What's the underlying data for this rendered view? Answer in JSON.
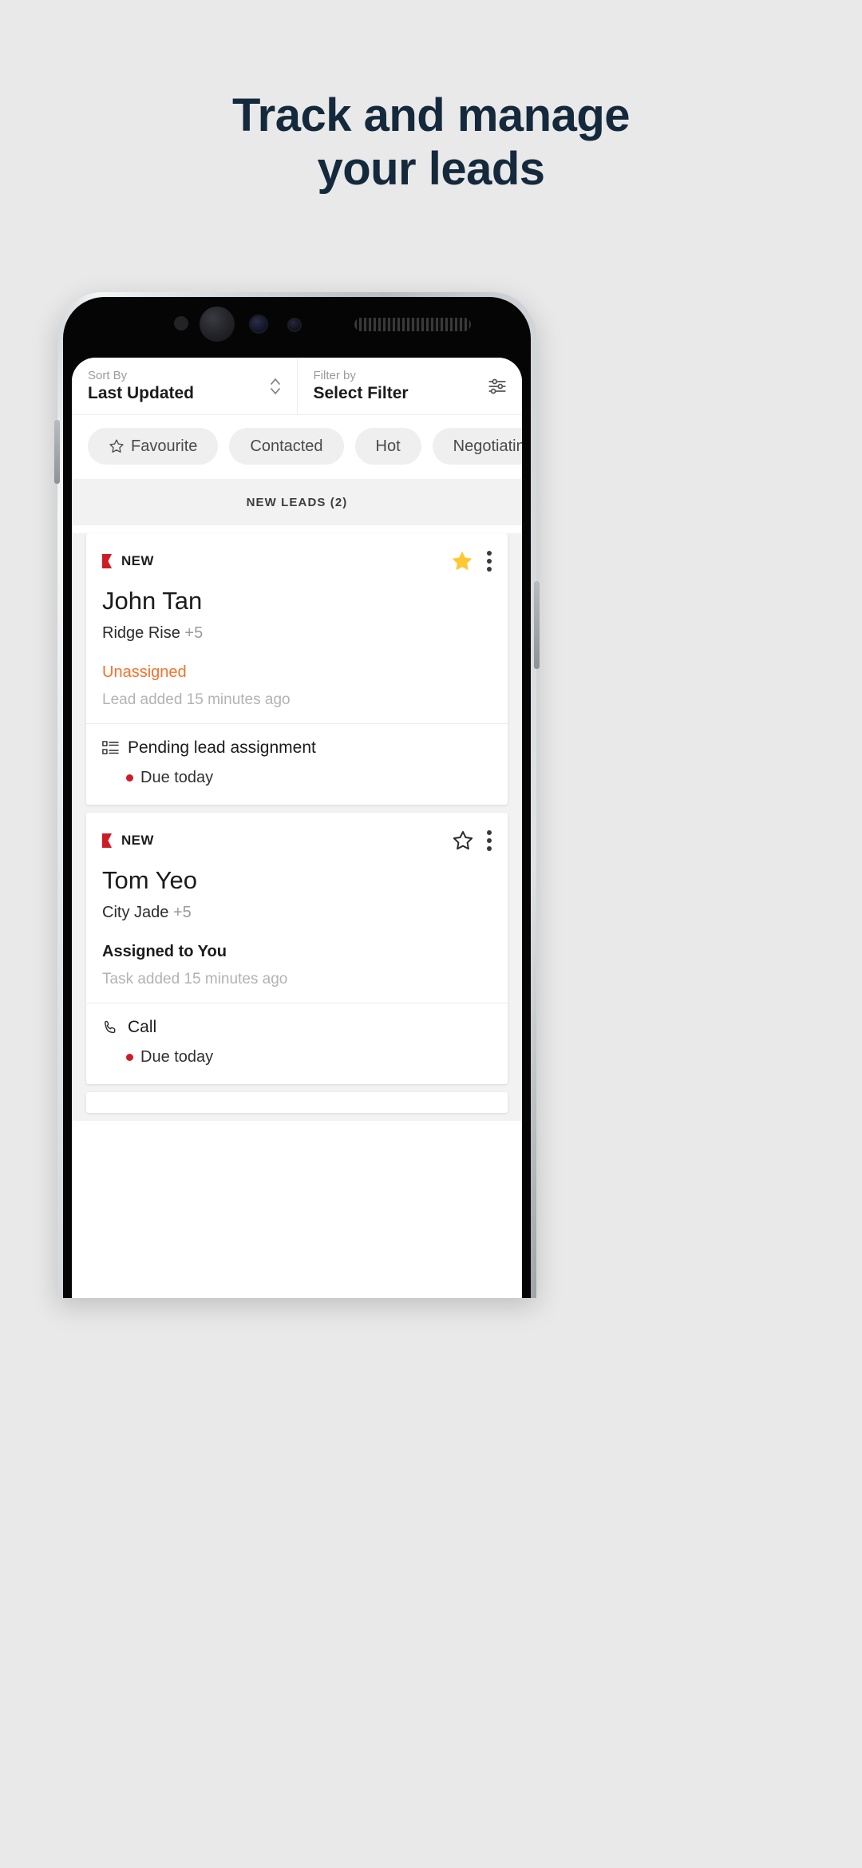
{
  "headline": {
    "line1": "Track and manage",
    "line2": "your leads",
    "color": "#15293d"
  },
  "app": {
    "topbar": {
      "sort": {
        "label": "Sort By",
        "value": "Last Updated",
        "icon": "sort-chevrons-icon"
      },
      "filter": {
        "label": "Filter by",
        "value": "Select Filter",
        "icon": "tune-sliders-icon"
      }
    },
    "chips": [
      {
        "label": "Favourite",
        "icon": "star-outline-icon"
      },
      {
        "label": "Contacted",
        "icon": null
      },
      {
        "label": "Hot",
        "icon": null
      },
      {
        "label": "Negotiating",
        "icon": null
      }
    ],
    "section_header": "NEW LEADS (2)",
    "cards": [
      {
        "badge": "NEW",
        "favourite": true,
        "name": "John Tan",
        "project": "Ridge Rise",
        "project_extra": "+5",
        "status": "Unassigned",
        "status_type": "unassigned",
        "time": "Lead added 15 minutes ago",
        "task_icon": "list-checklist-icon",
        "task_title": "Pending lead assignment",
        "task_due": "Due today"
      },
      {
        "badge": "NEW",
        "favourite": false,
        "name": "Tom Yeo",
        "project": "City Jade",
        "project_extra": "+5",
        "status": "Assigned to You",
        "status_type": "assigned",
        "time": "Task added 15 minutes ago",
        "task_icon": "phone-call-icon",
        "task_title": "Call",
        "task_due": "Due today"
      }
    ],
    "colors": {
      "new_badge": "#cf1b26",
      "unassigned": "#f4722b",
      "favourite_star": "#ffc832",
      "due_dot": "#cf1b26",
      "background": "#f2f2f2"
    }
  }
}
